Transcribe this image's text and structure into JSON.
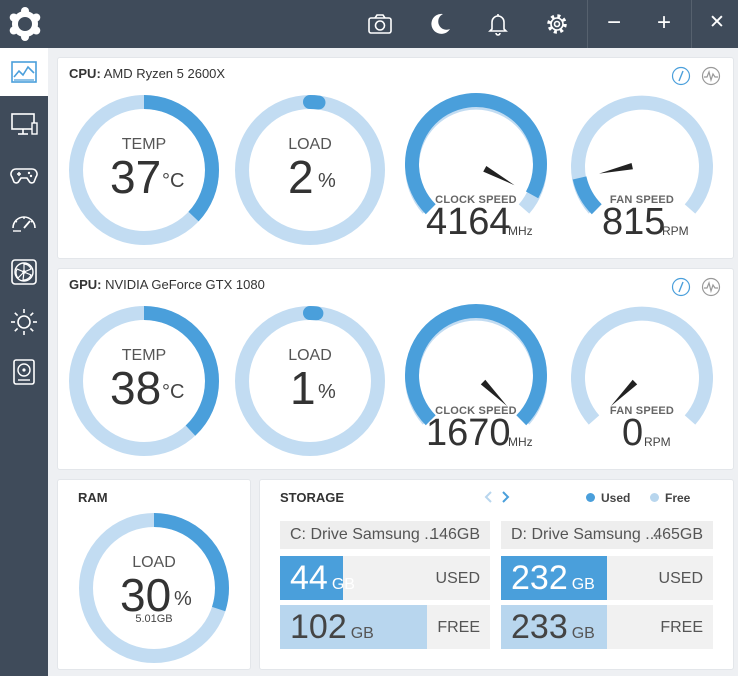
{
  "colors": {
    "accent": "#4a9fdb",
    "light": "#c2dcf2",
    "sidebar": "#3f4b5a",
    "used": "#4a9fdb",
    "free": "#b8d6ee"
  },
  "titlebar": {
    "icons": [
      "camera-icon",
      "moon-icon",
      "bell-icon",
      "gear-icon"
    ],
    "minimize": "−",
    "maximize": "+",
    "close": "✕"
  },
  "sidebar": {
    "items": [
      "dashboard-icon",
      "monitor-icon",
      "gamepad-icon",
      "speedometer-icon",
      "fan-icon",
      "brightness-icon",
      "storage-drive-icon"
    ]
  },
  "cpu": {
    "label": "CPU:",
    "name": "AMD Ryzen 5 2600X",
    "temp": {
      "label": "TEMP",
      "value": "37",
      "unit": "°C",
      "fraction": 0.37
    },
    "load": {
      "label": "LOAD",
      "value": "2",
      "unit": "%",
      "fraction": 0.02
    },
    "clock": {
      "label": "CLOCK SPEED",
      "value": "4164",
      "unit": "MHz",
      "fraction": 0.94
    },
    "fan": {
      "label": "FAN SPEED",
      "value": "815",
      "unit": "RPM",
      "fraction": 0.12
    }
  },
  "gpu": {
    "label": "GPU:",
    "name": "NVIDIA GeForce GTX 1080",
    "temp": {
      "label": "TEMP",
      "value": "38",
      "unit": "°C",
      "fraction": 0.38
    },
    "load": {
      "label": "LOAD",
      "value": "1",
      "unit": "%",
      "fraction": 0.01
    },
    "clock": {
      "label": "CLOCK SPEED",
      "value": "1670",
      "unit": "MHz",
      "fraction": 1.0
    },
    "fan": {
      "label": "FAN SPEED",
      "value": "0",
      "unit": "RPM",
      "fraction": 0.0
    }
  },
  "ram": {
    "title": "RAM",
    "label": "LOAD",
    "value": "30",
    "unit": "%",
    "sub": "5.01GB",
    "fraction": 0.3
  },
  "storage": {
    "title": "STORAGE",
    "legend_used": "Used",
    "legend_free": "Free",
    "drives": [
      {
        "name": "C: Drive Samsung ...",
        "size": "146GB",
        "used": "44",
        "free": "102",
        "gb": "GB",
        "used_tag": "USED",
        "free_tag": "FREE",
        "used_fraction": 0.3,
        "free_fraction": 0.7
      },
      {
        "name": "D: Drive Samsung ...",
        "size": "465GB",
        "used": "232",
        "gb": "GB",
        "free": "233",
        "used_tag": "USED",
        "free_tag": "FREE",
        "used_fraction": 0.5,
        "free_fraction": 0.5
      }
    ]
  }
}
